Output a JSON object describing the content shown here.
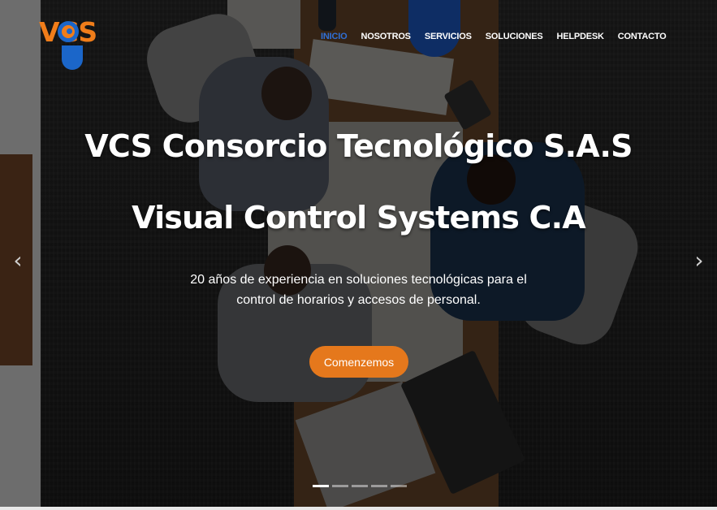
{
  "logo": {
    "text": "VCS"
  },
  "nav": {
    "items": [
      {
        "label": "INICIO",
        "active": true
      },
      {
        "label": "NOSOTROS"
      },
      {
        "label": "SERVICIOS"
      },
      {
        "label": "SOLUCIONES"
      },
      {
        "label": "HELPDESK"
      },
      {
        "label": "CONTACTO"
      }
    ]
  },
  "hero": {
    "title1": "VCS Consorcio Tecnológico S.A.S",
    "title2": "Visual Control Systems C.A",
    "subtitle_line1": "20 años de experiencia en soluciones tecnológicas para el",
    "subtitle_line2": "control de horarios y accesos de personal.",
    "cta_label": "Comenzemos",
    "prev_icon": "chevron-left-icon",
    "next_icon": "chevron-right-icon",
    "slide_count": 5,
    "active_slide": 1
  },
  "colors": {
    "accent_orange": "#e5781c",
    "logo_blue": "#1b66c9",
    "nav_active": "#2f6fd6"
  }
}
